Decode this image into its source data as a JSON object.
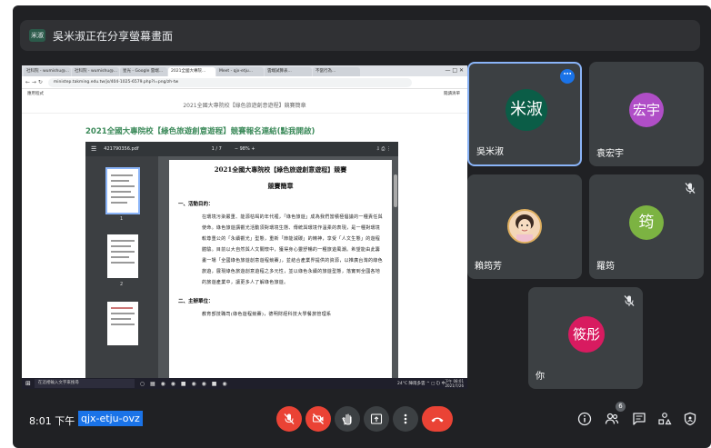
{
  "banner": {
    "logo_text": "米淑",
    "text": "吳米淑正在分享螢幕畫面"
  },
  "browser": {
    "tabs": [
      "社科院 - wumishu@...",
      "社科院 - wumishu@...",
      "星光 - Google 雲端...",
      "2021全國大專院...",
      "Meet - qjx-etju...",
      "雲端試算表...",
      "不當行為..."
    ],
    "window_controls": "—  □  ✕",
    "url": "ministep.takming.edu.tw/js/404-1025-6579.php?l=png/zh-tw",
    "bookmark_left": "應用程式",
    "bookmark_right": "閱讀清單",
    "page_header": "2021全國大專院校【綠色旅遊創意遊程】競賽簡章",
    "reg_title": "2021全國大專院校【綠色旅遊創意遊程】競賽報名連結(點我開啟)"
  },
  "pdf": {
    "filename": "421790356.pdf",
    "pages": "1 / 7",
    "zoom": "−   98%   +",
    "thumb_numbers": [
      "1",
      "2"
    ],
    "doc_title": "2021全國大專院校【綠色旅遊創意遊程】競賽",
    "doc_subtitle": "競賽簡章",
    "section1": "一、活動目的：",
    "para1": "在環境污染嚴重、能源枯竭的年代裡，「綠色旅遊」成為我們當積極倡議的一種責任與使命。綠色旅遊講觀光活動須對環境生態、傳統與環境作溫柔的表現，是一種對環境較尊重公的「永續觀光」型態，重新「節能減碳」的精神，享受「人文生態」的遊程體驗。目前以大自然與人文關懷中，獲得身心靈舒暢的一種旅遊風潮。希望能由此籌畫一場「全國綠色旅遊創意遊程競賽」，並結合產業界提供的資源，以推廣台灣的綠色旅遊，展現綠色旅遊創意遊程之多元性，並以綠色永續的旅遊型態，落實到全國各地的旅遊產業中，讓更多人了解綠色旅遊。",
    "section2": "二、主辦單位：",
    "para2": "教育部技職司(綠色遊程競賽)，德明財經科技大學餐旅管理系"
  },
  "taskbar": {
    "search_placeholder": "在這裡輸入文字來搜尋",
    "tray": "24°C  陣雨多雲  ^  □  ζ)  中",
    "time": "下午 08:01",
    "date": "2021/7/26"
  },
  "participants": [
    {
      "name": "吳米淑",
      "avatar_text": "米淑",
      "color": "#0b5d47",
      "muted": false
    },
    {
      "name": "袁宏宇",
      "avatar_text": "宏宇",
      "color": "#b04ec7",
      "muted": false
    },
    {
      "name": "賴筠芳",
      "avatar_text": "",
      "color": "#e8c08f",
      "muted": false
    },
    {
      "name": "羅筠",
      "avatar_text": "筠",
      "color": "#7cb342",
      "muted": true
    },
    {
      "name": "你",
      "avatar_text": "筱彤",
      "color": "#d81b60",
      "muted": true
    }
  ],
  "meeting": {
    "time": "8:01 下午",
    "code": "qjx-etju-ovz",
    "people_count": "6"
  },
  "colors": {
    "background": "#202124",
    "tile": "#3c4043",
    "hangup": "#ea4335",
    "active_border": "#8ab4f8",
    "code_highlight": "#1a73e8"
  }
}
